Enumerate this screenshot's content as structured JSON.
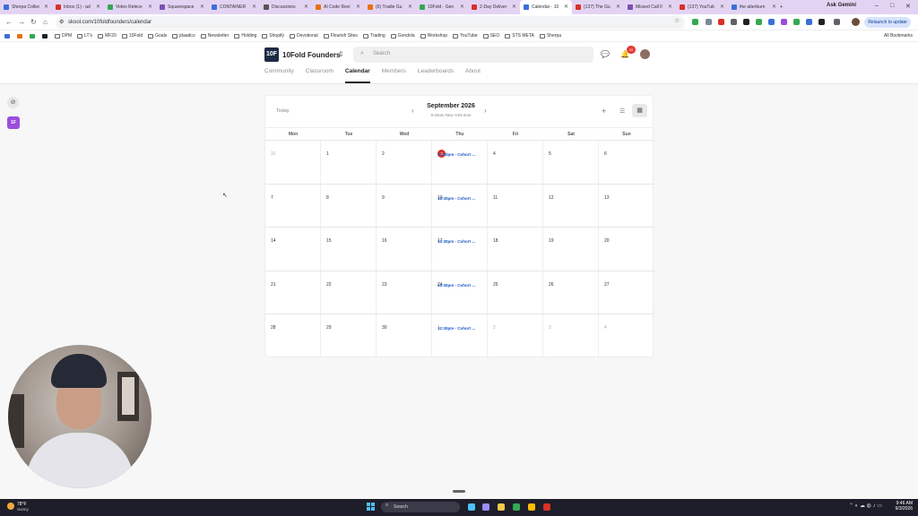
{
  "browser": {
    "tabs": [
      {
        "label": "Sherpa Collec",
        "color": "#3b6fd8"
      },
      {
        "label": "Inbox (1) - ad",
        "color": "#d93025"
      },
      {
        "label": "Video Relece",
        "color": "#34a853"
      },
      {
        "label": "Squarespace",
        "color": "#7b4fb5"
      },
      {
        "label": "CONTAINER",
        "color": "#3b6fd8"
      },
      {
        "label": "Discussions",
        "color": "#555555"
      },
      {
        "label": "AI Code Revi",
        "color": "#e8710a"
      },
      {
        "label": "(6) Tradie Gu",
        "color": "#e8710a"
      },
      {
        "label": "10Fold - Gen",
        "color": "#34a853"
      },
      {
        "label": "2-Day Deliver",
        "color": "#d93025"
      },
      {
        "label": "Calendar · 10",
        "color": "#3b6fd8"
      },
      {
        "label": "(137) The Gu",
        "color": "#d93025"
      },
      {
        "label": "Missed Call F",
        "color": "#7b4fb5"
      },
      {
        "label": "(137) YouTub",
        "color": "#d93025"
      },
      {
        "label": "the atterburn",
        "color": "#3b6fd8"
      }
    ],
    "active_tab_index": 10,
    "new_tab": "+",
    "gemini": "Ask Gemini",
    "url": "skool.com/10foldfounders/calendar",
    "relaunch": "Relaunch to update",
    "bookmarks": [
      "DPM",
      "LT's",
      "MF20",
      "10Fold",
      "Goals",
      "jdaadco",
      "Newsletter",
      "Holding",
      "Shopify",
      "Devotional",
      "Flourish Sites",
      "Trading",
      "Gondola",
      "Workshop",
      "YouTube",
      "SEO",
      "STS META",
      "Sherpa"
    ],
    "all_bookmarks": "All Bookmarks"
  },
  "header": {
    "logo_text": "10F",
    "group_name": "10Fold Founders",
    "search_placeholder": "Search",
    "notification_count": "20",
    "nav": [
      "Community",
      "Classroom",
      "Calendar",
      "Members",
      "Leaderboards",
      "About"
    ],
    "active_nav": "Calendar"
  },
  "rail": {
    "group_badge": "1F"
  },
  "calendar": {
    "today_label": "Today",
    "month": "September 2026",
    "timezone": "9:46am New York time",
    "weekdays": [
      "Mon",
      "Tue",
      "Wed",
      "Thu",
      "Fri",
      "Sat",
      "Sun"
    ],
    "weeks": [
      [
        {
          "d": "31",
          "m": true
        },
        {
          "d": "1"
        },
        {
          "d": "2"
        },
        {
          "d": "3",
          "today": true,
          "ev": "12:30pm - Cohort ..."
        },
        {
          "d": "4"
        },
        {
          "d": "5"
        },
        {
          "d": "6"
        }
      ],
      [
        {
          "d": "7"
        },
        {
          "d": "8"
        },
        {
          "d": "9"
        },
        {
          "d": "10",
          "ev": "12:30pm - Cohort ..."
        },
        {
          "d": "11"
        },
        {
          "d": "12"
        },
        {
          "d": "13"
        }
      ],
      [
        {
          "d": "14"
        },
        {
          "d": "15"
        },
        {
          "d": "16"
        },
        {
          "d": "17",
          "ev": "12:30pm - Cohort ..."
        },
        {
          "d": "18"
        },
        {
          "d": "19"
        },
        {
          "d": "20"
        }
      ],
      [
        {
          "d": "21"
        },
        {
          "d": "22"
        },
        {
          "d": "23"
        },
        {
          "d": "24",
          "ev": "12:30pm - Cohort ..."
        },
        {
          "d": "25"
        },
        {
          "d": "26"
        },
        {
          "d": "27"
        }
      ],
      [
        {
          "d": "28"
        },
        {
          "d": "29"
        },
        {
          "d": "30"
        },
        {
          "d": "1",
          "m": true,
          "ev": "12:30pm - Cohort ..."
        },
        {
          "d": "2",
          "m": true
        },
        {
          "d": "3",
          "m": true
        },
        {
          "d": "4",
          "m": true
        }
      ]
    ]
  },
  "taskbar": {
    "temperature": "78°F",
    "condition": "Sunny",
    "search": "Search",
    "time": "9:46 AM",
    "date": "9/3/2026"
  }
}
